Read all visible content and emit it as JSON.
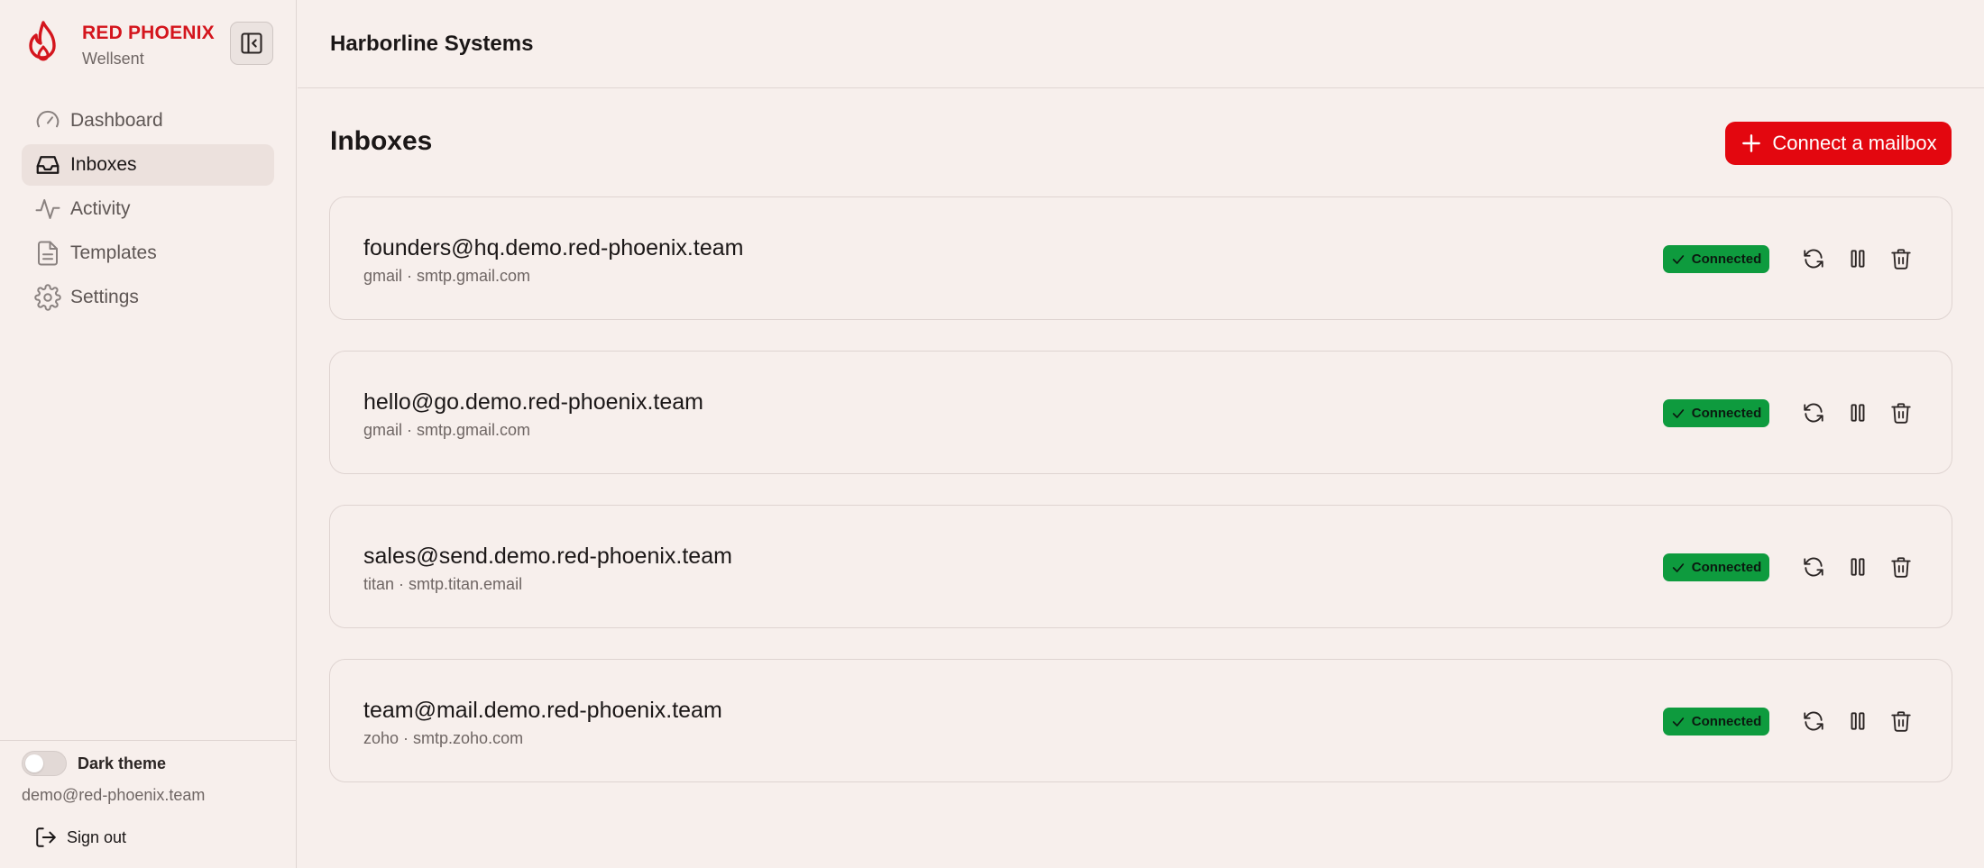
{
  "brand": {
    "name": "RED PHOENIX",
    "subtitle": "Wellsent",
    "logo_icon": "flame-icon",
    "accent_color": "#d4151d"
  },
  "sidebar": {
    "collapse_icon": "sidebar-collapse-icon",
    "items": [
      {
        "label": "Dashboard",
        "icon": "gauge-icon",
        "active": false
      },
      {
        "label": "Inboxes",
        "icon": "inbox-icon",
        "active": true
      },
      {
        "label": "Activity",
        "icon": "activity-icon",
        "active": false
      },
      {
        "label": "Templates",
        "icon": "file-text-icon",
        "active": false
      },
      {
        "label": "Settings",
        "icon": "gear-icon",
        "active": false
      }
    ],
    "footer": {
      "theme_label": "Dark theme",
      "theme_on": false,
      "user_email": "demo@red-phoenix.team",
      "signout_label": "Sign out"
    }
  },
  "header": {
    "org_name": "Harborline Systems"
  },
  "main": {
    "title": "Inboxes",
    "connect_label": "Connect a mailbox",
    "connect_color": "#e3070f",
    "inboxes": [
      {
        "email": "founders@hq.demo.red-phoenix.team",
        "meta": "gmail · smtp.gmail.com",
        "status": "Connected"
      },
      {
        "email": "hello@go.demo.red-phoenix.team",
        "meta": "gmail · smtp.gmail.com",
        "status": "Connected"
      },
      {
        "email": "sales@send.demo.red-phoenix.team",
        "meta": "titan · smtp.titan.email",
        "status": "Connected"
      },
      {
        "email": "team@mail.demo.red-phoenix.team",
        "meta": "zoho · smtp.zoho.com",
        "status": "Connected"
      }
    ],
    "status_color": "#0e9b3e"
  }
}
